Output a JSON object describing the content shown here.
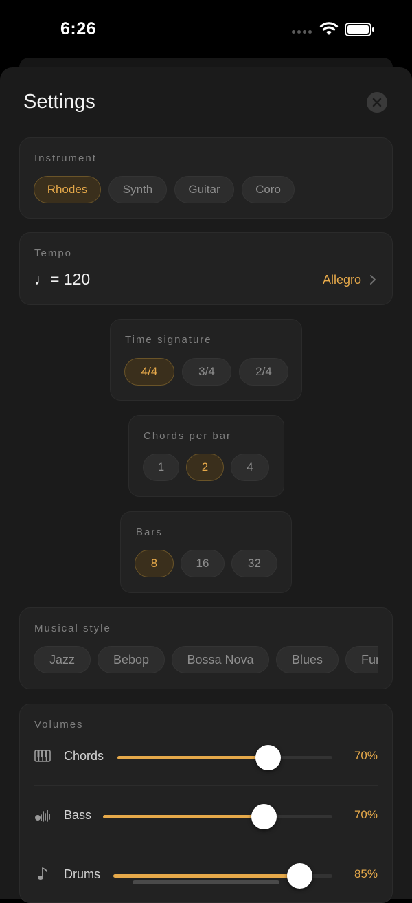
{
  "status": {
    "time": "6:26"
  },
  "title": "Settings",
  "instrument": {
    "label": "Instrument",
    "options": [
      "Rhodes",
      "Synth",
      "Guitar",
      "Coro"
    ],
    "selected": "Rhodes"
  },
  "tempo": {
    "label": "Tempo",
    "value": "♩= 120",
    "style": "Allegro"
  },
  "time_signature": {
    "label": "Time signature",
    "options": [
      "4/4",
      "3/4",
      "2/4"
    ],
    "selected": "4/4"
  },
  "chords_per_bar": {
    "label": "Chords per bar",
    "options": [
      "1",
      "2",
      "4"
    ],
    "selected": "2"
  },
  "bars": {
    "label": "Bars",
    "options": [
      "8",
      "16",
      "32"
    ],
    "selected": "8"
  },
  "musical_style": {
    "label": "Musical style",
    "options": [
      "Jazz",
      "Bebop",
      "Bossa Nova",
      "Blues",
      "Funk"
    ]
  },
  "volumes": {
    "label": "Volumes",
    "items": [
      {
        "name": "Chords",
        "percent_label": "70%",
        "level": 0.7,
        "icon": "piano-icon"
      },
      {
        "name": "Bass",
        "percent_label": "70%",
        "level": 0.7,
        "icon": "waveform-icon"
      },
      {
        "name": "Drums",
        "percent_label": "85%",
        "level": 0.85,
        "icon": "music-note-icon"
      }
    ]
  },
  "colors": {
    "accent": "#e6a94a",
    "background": "#1b1b1b",
    "card": "#222222"
  }
}
